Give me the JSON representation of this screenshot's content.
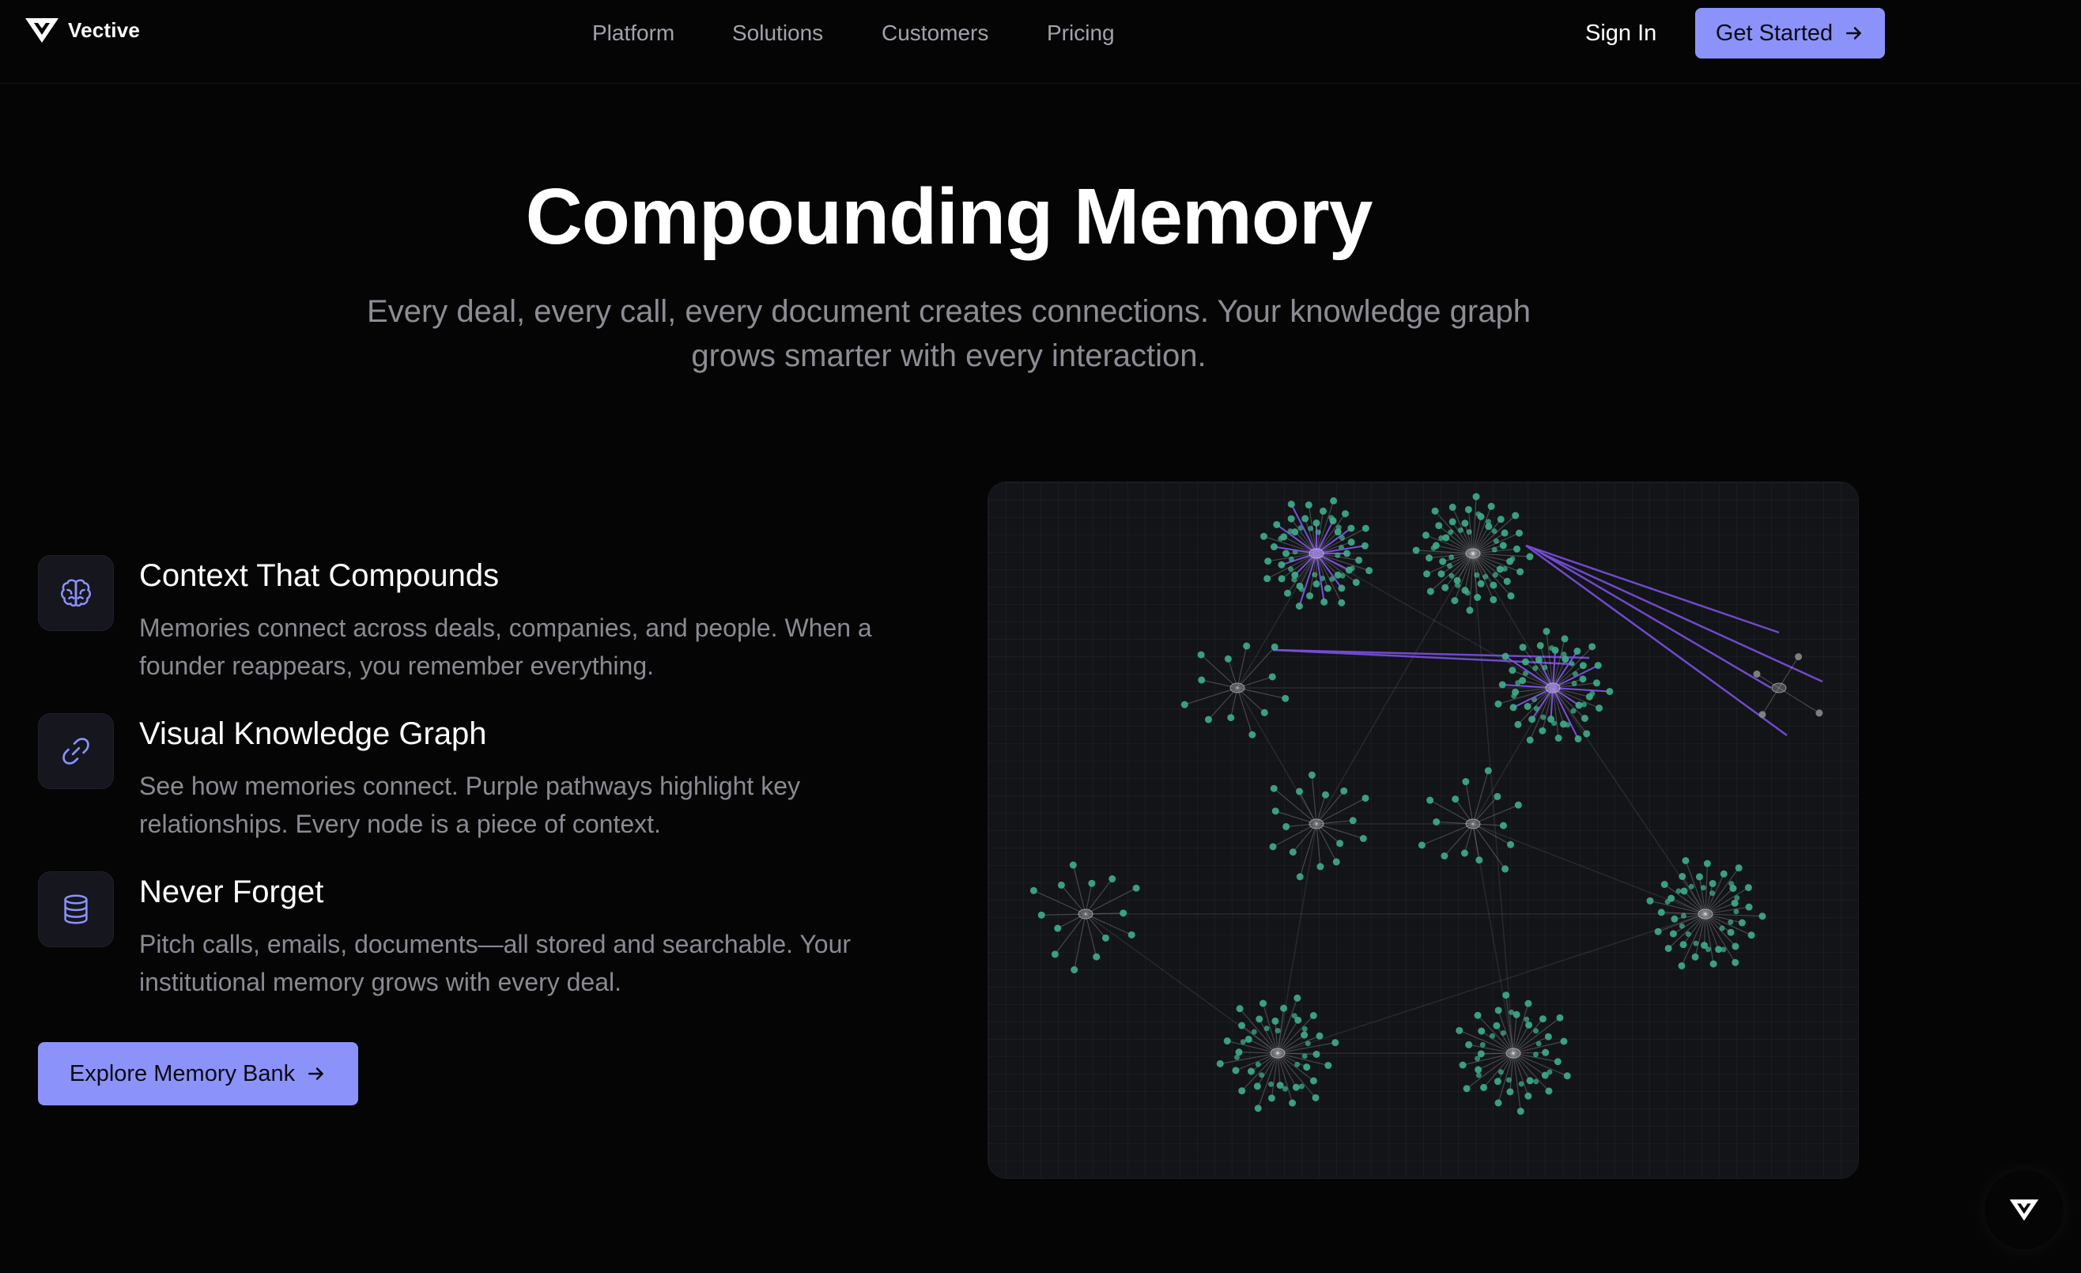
{
  "nav": {
    "brand": "Vective",
    "links": [
      "Platform",
      "Solutions",
      "Customers",
      "Pricing"
    ],
    "sign_in": "Sign In",
    "get_started": "Get Started"
  },
  "hero": {
    "title": "Compounding Memory",
    "subtitle": "Every deal, every call, every document creates connections. Your knowledge graph grows smarter with every interaction."
  },
  "features": [
    {
      "icon": "brain-icon",
      "title": "Context That Compounds",
      "description": "Memories connect across deals, companies, and people. When a founder reappears, you remember everything."
    },
    {
      "icon": "link-icon",
      "title": "Visual Knowledge Graph",
      "description": "See how memories connect. Purple pathways highlight key relationships. Every node is a piece of context."
    },
    {
      "icon": "database-icon",
      "title": "Never Forget",
      "description": "Pitch calls, emails, documents—all stored and searchable. Your institutional memory grows with every deal."
    }
  ],
  "cta": {
    "explore": "Explore Memory Bank"
  },
  "colors": {
    "accent": "#8b93fb",
    "node_green": "#3fae8a",
    "pathway_purple": "#7b4fe0",
    "background": "#050506",
    "muted_text": "#8a8a92"
  }
}
